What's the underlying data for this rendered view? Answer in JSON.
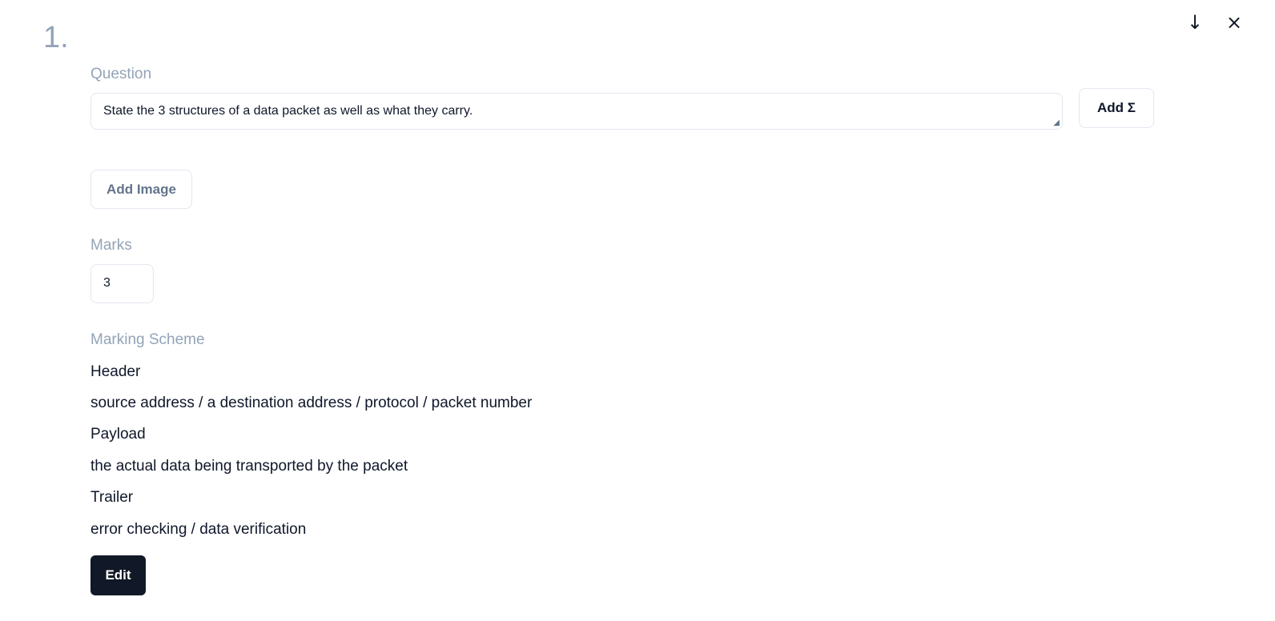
{
  "question_number": "1.",
  "icons": {
    "move_down": "↓",
    "close": "×"
  },
  "question": {
    "label": "Question",
    "value": "State the 3 structures of a data packet as well as what they carry.",
    "add_sigma_label": "Add Σ"
  },
  "add_image_label": "Add Image",
  "marks": {
    "label": "Marks",
    "value": "3"
  },
  "marking_scheme": {
    "label": "Marking Scheme",
    "lines": [
      "Header",
      "source address / a destination address / protocol / packet number",
      "Payload",
      "the actual data being transported by the packet",
      "Trailer",
      "error checking / data verification"
    ]
  },
  "edit_label": "Edit"
}
